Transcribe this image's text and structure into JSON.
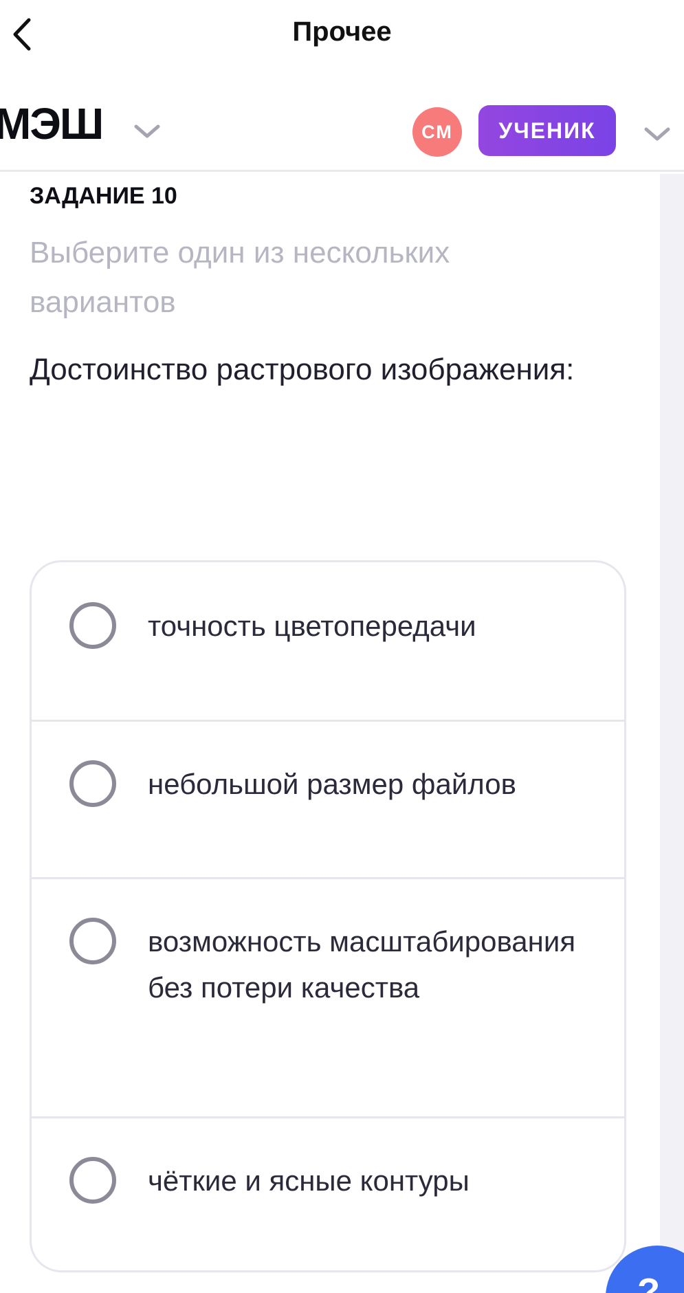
{
  "topbar": {
    "title": "Прочее"
  },
  "appbar": {
    "logo": "МЭШ",
    "avatar_initials": "СМ",
    "role": "УЧЕНИК"
  },
  "task": {
    "label": "ЗАДАНИЕ 10",
    "hint": "Выберите один из нескольких вариантов",
    "question": "Достоинство растрового изображения:"
  },
  "options": [
    {
      "text": "точность цветопередачи"
    },
    {
      "text": "небольшой размер файлов"
    },
    {
      "text": "возможность масштабирования без потери качества"
    },
    {
      "text": "чёткие и ясные контуры"
    }
  ],
  "help": {
    "label": "?"
  }
}
